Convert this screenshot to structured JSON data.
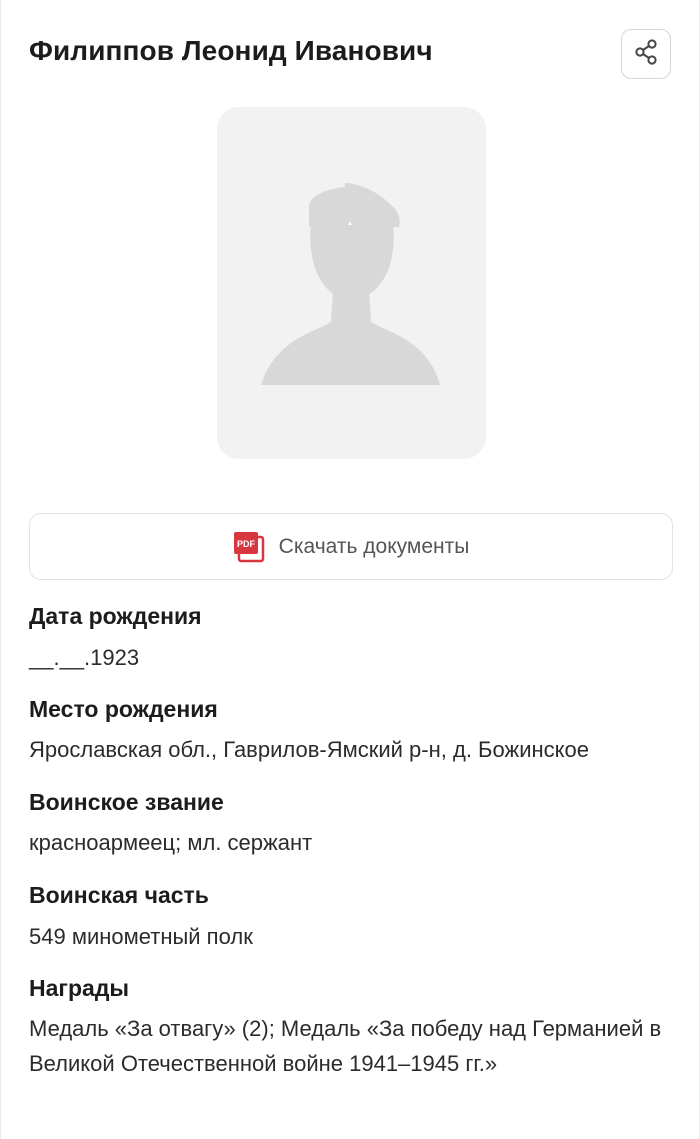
{
  "person": {
    "name": "Филиппов Леонид Иванович"
  },
  "icons": {
    "share": "share-icon",
    "pdf": "pdf-icon",
    "photo_placeholder": "soldier-silhouette-icon"
  },
  "colors": {
    "pdf_red": "#d9373f",
    "placeholder_bg": "#f2f2f2",
    "silhouette": "#d8d8d8"
  },
  "download": {
    "label": "Скачать документы"
  },
  "fields": {
    "birth_date": {
      "label": "Дата рождения",
      "value": "__.__.1923"
    },
    "birth_place": {
      "label": "Место рождения",
      "value": "Ярославская обл., Гаврилов-Ямский р-н, д. Божинское"
    },
    "rank": {
      "label": "Воинское звание",
      "value": "красноармеец; мл. сержант"
    },
    "unit": {
      "label": "Воинская часть",
      "value": "549 минометный полк"
    },
    "awards": {
      "label": "Награды",
      "value": "Медаль «За отвагу» (2); Медаль «За победу над Германией в Великой Отечественной войне 1941–1945 гг.»"
    }
  }
}
